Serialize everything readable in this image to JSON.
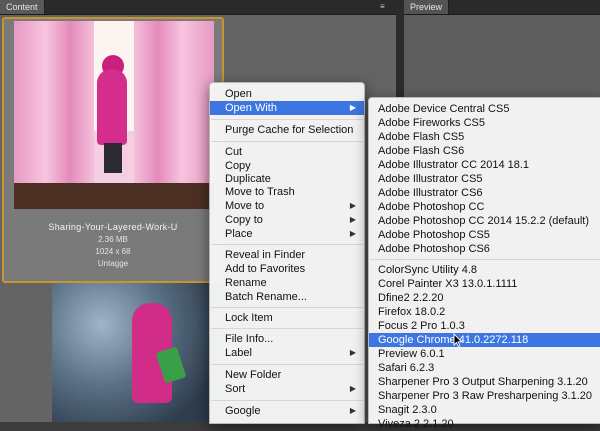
{
  "panels": {
    "content_tab": "Content",
    "preview_tab": "Preview"
  },
  "thumbnail": {
    "name": "Sharing-Your-Layered-Work-U",
    "size": "2.36 MB",
    "dimensions": "1024 x 68",
    "label": "Untagge"
  },
  "context_menu": {
    "items": [
      {
        "label": "Open"
      },
      {
        "label": "Open With"
      },
      {
        "label": "Purge Cache for Selection"
      },
      {
        "label": "Cut"
      },
      {
        "label": "Copy"
      },
      {
        "label": "Duplicate"
      },
      {
        "label": "Move to Trash"
      },
      {
        "label": "Move to"
      },
      {
        "label": "Copy to"
      },
      {
        "label": "Place"
      },
      {
        "label": "Reveal in Finder"
      },
      {
        "label": "Add to Favorites"
      },
      {
        "label": "Rename"
      },
      {
        "label": "Batch Rename..."
      },
      {
        "label": "Lock Item"
      },
      {
        "label": "File Info..."
      },
      {
        "label": "Label"
      },
      {
        "label": "New Folder"
      },
      {
        "label": "Sort"
      },
      {
        "label": "Google"
      }
    ]
  },
  "open_with_menu": {
    "items": [
      {
        "label": "Adobe Device Central CS5"
      },
      {
        "label": "Adobe Fireworks CS5"
      },
      {
        "label": "Adobe Flash CS5"
      },
      {
        "label": "Adobe Flash CS6"
      },
      {
        "label": "Adobe Illustrator CC 2014 18.1"
      },
      {
        "label": "Adobe Illustrator CS5"
      },
      {
        "label": "Adobe Illustrator CS6"
      },
      {
        "label": "Adobe Photoshop CC"
      },
      {
        "label": "Adobe Photoshop CC 2014 15.2.2 (default)"
      },
      {
        "label": "Adobe Photoshop CS5"
      },
      {
        "label": "Adobe Photoshop CS6"
      },
      {
        "label": "ColorSync Utility 4.8"
      },
      {
        "label": "Corel Painter X3 13.0.1.1111"
      },
      {
        "label": "Dfine2 2.2.20"
      },
      {
        "label": "Firefox 18.0.2"
      },
      {
        "label": "Focus 2 Pro 1.0.3"
      },
      {
        "label": "Google Chrome 41.0.2272.118"
      },
      {
        "label": "Preview 6.0.1"
      },
      {
        "label": "Safari 6.2.3"
      },
      {
        "label": "Sharpener Pro 3 Output Sharpening 3.1.20"
      },
      {
        "label": "Sharpener Pro 3 Raw Presharpening 3.1.20"
      },
      {
        "label": "Snagit 2.3.0"
      },
      {
        "label": "Viveza 2 2.1.20"
      }
    ]
  },
  "colors": {
    "highlight": "#3d75e3",
    "selection_border": "#c9942d"
  },
  "icons": {
    "submenu_arrow": "triangle-right-icon",
    "panel_menu": "panel-menu-icon"
  }
}
